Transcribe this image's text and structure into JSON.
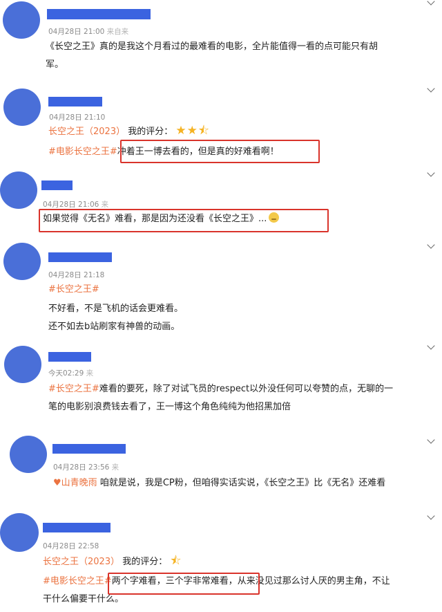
{
  "comments": [
    {
      "time": "04月28日 21:00",
      "source_fragment": "来自来",
      "lines": [
        "《长空之王》真的是我这个月看过的最难看的电影，全片能值得一看的点可能只有胡",
        "军。"
      ]
    },
    {
      "time": "04月28日 21:10",
      "rating_label": "长空之王（2023）",
      "rating_text": "我的评分：",
      "stars": "★★⯪",
      "tag": "#电影长空之王#",
      "text": "冲着王一博去看的，但是真的好难看啊！"
    },
    {
      "time": "04月28日 21:06",
      "source_fragment": "来",
      "text": "如果觉得《无名》难看，那是因为还没看《长空之王》..."
    },
    {
      "time": "04月28日 21:18",
      "tag": "#长空之王#",
      "lines": [
        "不好看，不是飞机的话会更难看。",
        "还不如去b站刷家有神兽的动画。"
      ]
    },
    {
      "time": "今天02:29",
      "source_fragment": "来",
      "tag": "#长空之王#",
      "lines": [
        "难看的要死，除了对试飞员的respect以外没任何可以夸赞的点，无聊的一",
        "笔的电影别浪费钱去看了，王一博这个角色纯纯为他招黑加倍"
      ]
    },
    {
      "time": "04月28日 23:56",
      "source_fragment": "来",
      "reply_to": "山青晚雨",
      "text": "咱就是说，我是CP粉，但咱得实话实说，《长空之王》比《无名》还难看"
    },
    {
      "time": "04月28日 22:58",
      "rating_label": "长空之王（2023）",
      "rating_text": "我的评分：",
      "stars": "⯪",
      "tag": "#电影长空之王#",
      "lines": [
        "两个字难看，三个字非常难看，从来没见过那么讨人厌的男主角，不让",
        "干什么偏要干什么。"
      ]
    }
  ],
  "colors": {
    "avatar": "#4a6fd8",
    "name_redaction": "#3b63e0",
    "tag": "#eb7340",
    "star": "#f5b323",
    "highlight_box": "#d9332b"
  },
  "icons": {
    "expand": "chevron-down-icon",
    "reply": "heart-icon",
    "emoji": "emoji-icon"
  }
}
